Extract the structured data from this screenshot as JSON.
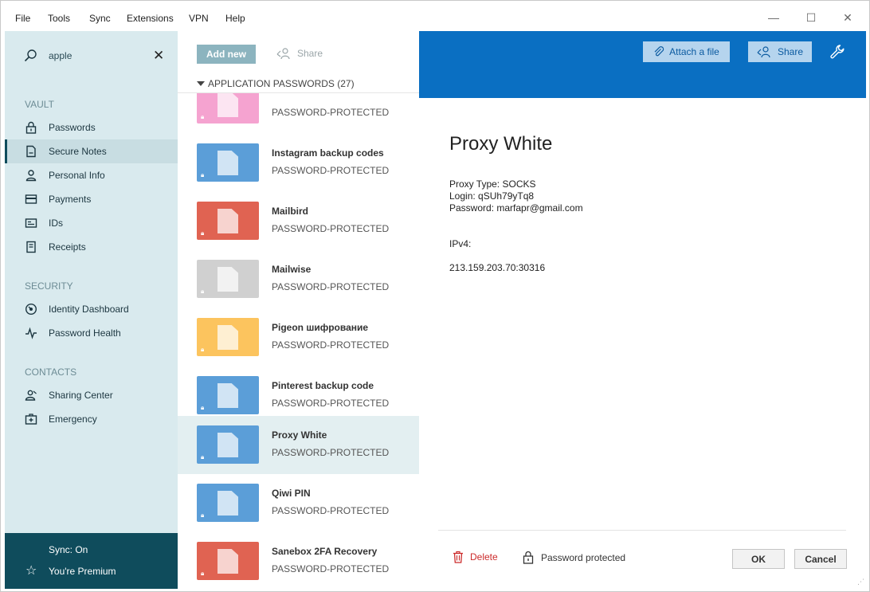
{
  "menu": {
    "file": "File",
    "tools": "Tools",
    "sync": "Sync",
    "extensions": "Extensions",
    "vpn": "VPN",
    "help": "Help"
  },
  "window_controls": {
    "minimize": "—",
    "maximize": "☐",
    "close": "✕"
  },
  "sidebar": {
    "search_value": "apple",
    "clear_symbol": "✕",
    "sections": [
      {
        "title": "VAULT"
      },
      {
        "title": "SECURITY"
      },
      {
        "title": "CONTACTS"
      }
    ],
    "items": [
      {
        "label": "Passwords",
        "icon": "lock-icon"
      },
      {
        "label": "Secure Notes",
        "icon": "note-icon",
        "active": true
      },
      {
        "label": "Personal Info",
        "icon": "person-icon"
      },
      {
        "label": "Payments",
        "icon": "card-icon"
      },
      {
        "label": "IDs",
        "icon": "id-card-icon"
      },
      {
        "label": "Receipts",
        "icon": "receipt-icon"
      },
      {
        "label": "Identity Dashboard",
        "icon": "dashboard-icon"
      },
      {
        "label": "Password Health",
        "icon": "pulse-icon"
      },
      {
        "label": "Sharing Center",
        "icon": "people-icon"
      },
      {
        "label": "Emergency",
        "icon": "emergency-icon"
      }
    ],
    "footer": {
      "sync": "Sync: On",
      "premium": "You're Premium",
      "premium_icon": "☆"
    }
  },
  "list": {
    "add_new": "Add new",
    "share": "Share",
    "category": "APPLICATION PASSWORDS (27)",
    "items": [
      {
        "title": "",
        "sub": "PASSWORD-PROTECTED",
        "color": "#f5a3d0"
      },
      {
        "title": "Instagram backup codes",
        "sub": "PASSWORD-PROTECTED",
        "color": "#5b9ed8"
      },
      {
        "title": "Mailbird",
        "sub": "PASSWORD-PROTECTED",
        "color": "#e06352"
      },
      {
        "title": "Mailwise",
        "sub": "PASSWORD-PROTECTED",
        "color": "#d0d0d0"
      },
      {
        "title": "Pigeon шифрование",
        "sub": "PASSWORD-PROTECTED",
        "color": "#fcc45e"
      },
      {
        "title": "Pinterest backup code",
        "sub": "PASSWORD-PROTECTED",
        "color": "#5b9ed8"
      },
      {
        "title": "Proxy White",
        "sub": "PASSWORD-PROTECTED",
        "color": "#5b9ed8",
        "active": true
      },
      {
        "title": "Qiwi PIN",
        "sub": "PASSWORD-PROTECTED",
        "color": "#5b9ed8"
      },
      {
        "title": "Sanebox 2FA Recovery",
        "sub": "PASSWORD-PROTECTED",
        "color": "#e06352"
      }
    ]
  },
  "detail": {
    "attach": "Attach a file",
    "share": "Share",
    "title": "Proxy White",
    "lines": [
      "Proxy Type: SOCKS",
      "Login: qSUh79yTq8",
      "Password: marfapr@gmail.com",
      "IPv4:",
      "213.159.203.70:30316"
    ],
    "delete": "Delete",
    "password_protected": "Password protected",
    "ok": "OK",
    "cancel": "Cancel"
  },
  "colors": {
    "accent": "#0a6fc2",
    "sidebar_bg": "#d9eaee",
    "sidebar_footer": "#0f4c5c",
    "delete_red": "#cc2b2b"
  }
}
